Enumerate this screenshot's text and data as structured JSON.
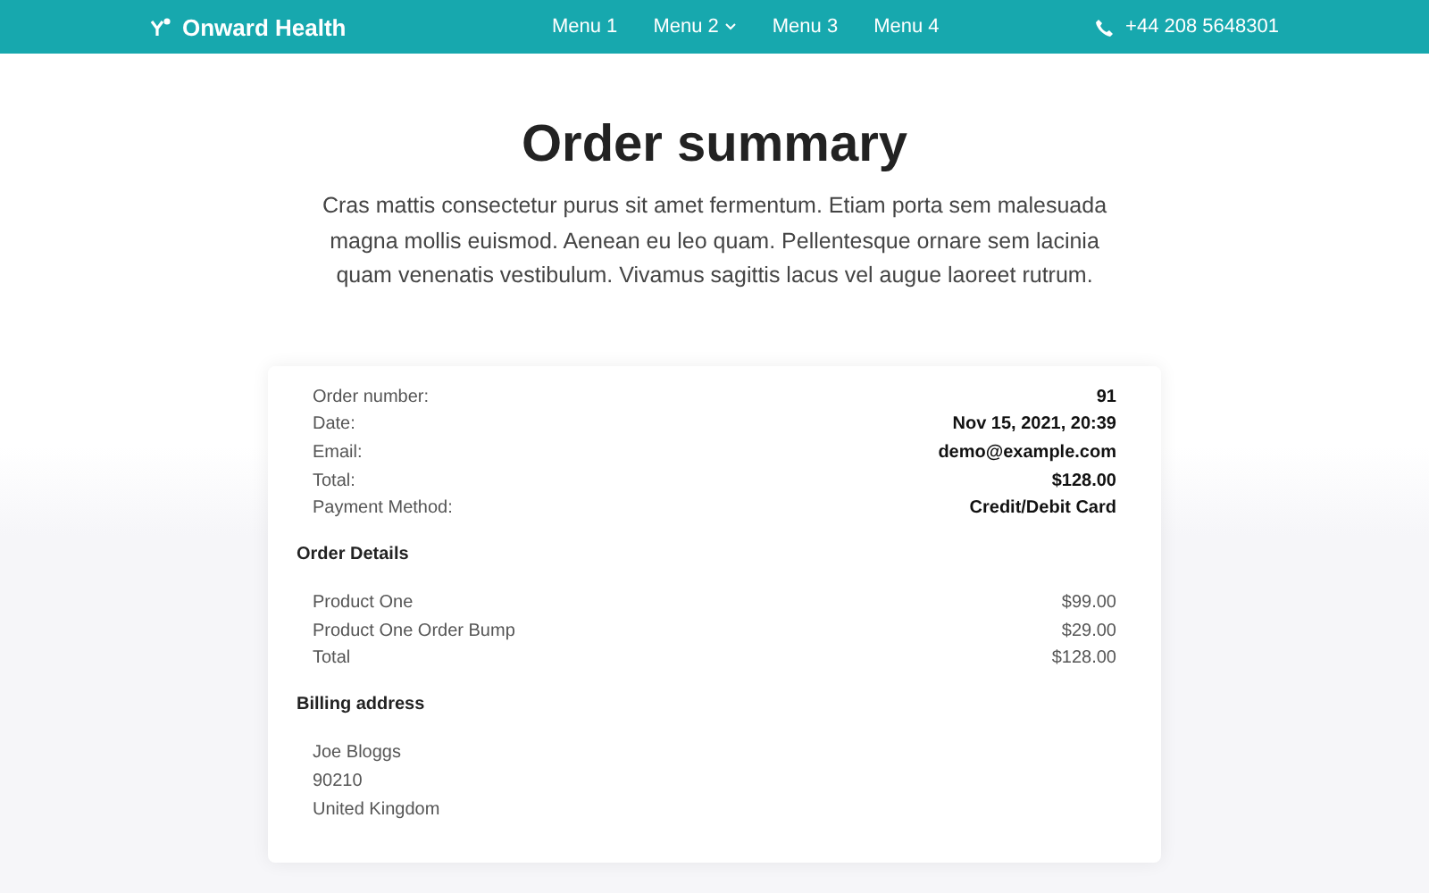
{
  "header": {
    "brand": "Onward Health",
    "menu": [
      {
        "label": "Menu 1",
        "has_dropdown": false
      },
      {
        "label": "Menu 2",
        "has_dropdown": true
      },
      {
        "label": "Menu 3",
        "has_dropdown": false
      },
      {
        "label": "Menu 4",
        "has_dropdown": false
      }
    ],
    "phone": "+44 208 5648301"
  },
  "title": "Order summary",
  "intro": "Cras mattis consectetur purus sit amet fermentum. Etiam porta sem malesuada magna mollis euismod. Aenean eu leo quam. Pellentesque ornare sem lacinia quam venenatis vestibulum. Vivamus sagittis lacus vel augue laoreet rutrum.",
  "order_info": [
    {
      "label": "Order number:",
      "value": "91"
    },
    {
      "label": "Date:",
      "value": "Nov 15, 2021, 20:39"
    },
    {
      "label": "Email:",
      "value": "demo@example.com"
    },
    {
      "label": "Total:",
      "value": "$128.00"
    },
    {
      "label": "Payment Method:",
      "value": "Credit/Debit Card"
    }
  ],
  "order_details": {
    "heading": "Order Details",
    "items": [
      {
        "name": "Product One",
        "price": "$99.00"
      },
      {
        "name": "Product One Order Bump",
        "price": "$29.00"
      },
      {
        "name": "Total",
        "price": "$128.00"
      }
    ]
  },
  "billing_address": {
    "heading": "Billing address",
    "lines": [
      "Joe Bloggs",
      "90210",
      "United Kingdom"
    ]
  }
}
